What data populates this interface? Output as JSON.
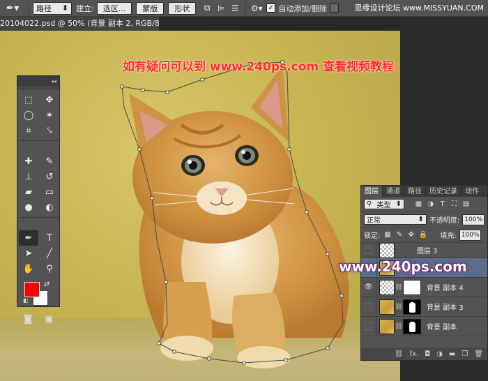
{
  "options_bar": {
    "tool_icon": "pen-icon",
    "mode_value": "路径",
    "make_label": "建立:",
    "selection_button": "选区...",
    "mask_button": "蒙版",
    "shape_button": "形状",
    "auto_add_delete_label": "自动添加/删除",
    "auto_add_delete_checked": true,
    "align_edges_checked": false,
    "site_watermark": "思缘设计论坛 www.MISSYUAN.COM"
  },
  "document_tab": {
    "title": "20104022.psd @ 50% (背景 副本 2, RGB/8#) *"
  },
  "canvas": {
    "headline": "如有疑问可以到 www.240ps.com 查看视频教程",
    "watermark": "www.240ps.com"
  },
  "tools_panel": {
    "collapse_label": "◂◂",
    "foreground_color": "#ff0000",
    "background_color": "#ffffff"
  },
  "layers_panel": {
    "tabs": [
      {
        "label": "图层",
        "active": true
      },
      {
        "label": "通道",
        "active": false
      },
      {
        "label": "路径",
        "active": false
      },
      {
        "label": "历史记录",
        "active": false
      },
      {
        "label": "动作",
        "active": false
      }
    ],
    "filter_value": "类型",
    "blend_mode": "正常",
    "opacity_label": "不透明度:",
    "opacity_value": "100%",
    "lock_label": "锁定:",
    "fill_label": "填充:",
    "fill_value": "100%",
    "layers": [
      {
        "name": "图层 3",
        "visible": false,
        "selected": false,
        "thumb": "checker",
        "mask": "none"
      },
      {
        "name": "背景 副本 2",
        "visible": true,
        "selected": true,
        "thumb": "photo",
        "mask": "none"
      },
      {
        "name": "背景 副本 4",
        "visible": true,
        "selected": false,
        "thumb": "checker",
        "mask": "white"
      },
      {
        "name": "背景 副本 3",
        "visible": false,
        "selected": false,
        "thumb": "photo",
        "mask": "black"
      },
      {
        "name": "背景 副本",
        "visible": false,
        "selected": false,
        "thumb": "photo",
        "mask": "black"
      }
    ],
    "footer_icons": [
      "link-icon",
      "fx-icon",
      "mask-icon",
      "adjustment-icon",
      "folder-icon",
      "new-layer-icon",
      "trash-icon"
    ],
    "fx_label": "fx."
  }
}
